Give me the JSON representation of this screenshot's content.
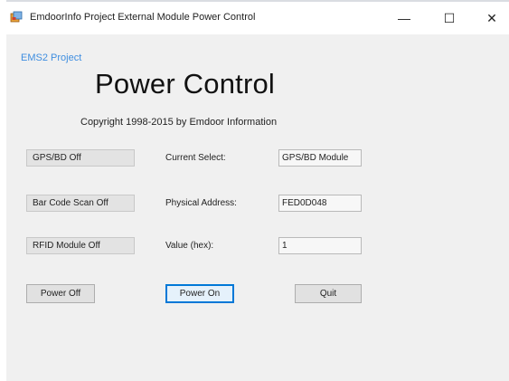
{
  "window": {
    "title": "EmdoorInfo Project External Module Power Control",
    "minimize_glyph": "—",
    "maximize_glyph": "☐",
    "close_glyph": "✕"
  },
  "header": {
    "project_label": "EMS2 Project",
    "title": "Power Control",
    "copyright": "Copyright 1998-2015 by Emdoor Information"
  },
  "status": {
    "gps": "GPS/BD  Off",
    "barcode": "Bar Code Scan Off",
    "rfid": "RFID Module Off"
  },
  "fields": {
    "current_select_label": "Current Select:",
    "current_select_value": "GPS/BD Module",
    "physical_address_label": "Physical Address:",
    "physical_address_value": "FED0D048",
    "value_label": "Value  (hex):",
    "value_value": "1"
  },
  "buttons": {
    "power_off": "Power Off",
    "power_on": "Power On",
    "quit": "Quit"
  },
  "colors": {
    "project_label": "#3f8ee0",
    "focus_border": "#0078d7",
    "client_bg": "#f0f0f0"
  },
  "icons": {
    "app": "app-icon"
  }
}
